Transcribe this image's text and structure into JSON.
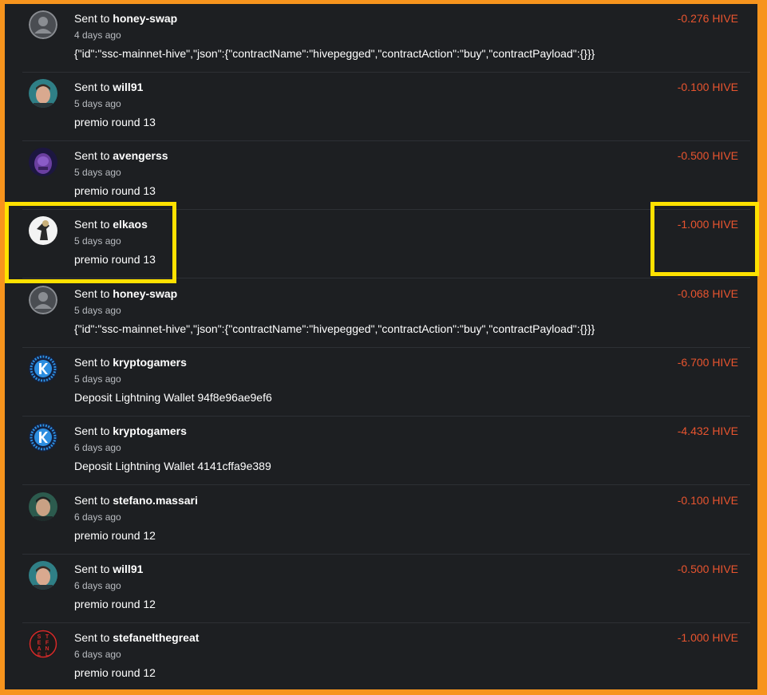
{
  "colors": {
    "frame_border": "#f7941d",
    "background": "#1d1f22",
    "amount": "#e8542f",
    "highlight": "#ffe100"
  },
  "transfers": [
    {
      "prefix": "Sent to",
      "to": "honey-swap",
      "time": "4 days ago",
      "memo": "{\"id\":\"ssc-mainnet-hive\",\"json\":{\"contractName\":\"hivepegged\",\"contractAction\":\"buy\",\"contractPayload\":{}}}",
      "amount": "-0.276 HIVE",
      "avatar": "default-user-icon"
    },
    {
      "prefix": "Sent to",
      "to": "will91",
      "time": "5 days ago",
      "memo": "premio round 13",
      "amount": "-0.100 HIVE",
      "avatar": "user-photo-avatar"
    },
    {
      "prefix": "Sent to",
      "to": "avengerss",
      "time": "5 days ago",
      "memo": "premio round 13",
      "amount": "-0.500 HIVE",
      "avatar": "purple-character-avatar"
    },
    {
      "prefix": "Sent to",
      "to": "elkaos",
      "time": "5 days ago",
      "memo": "premio round 13",
      "amount": "-1.000 HIVE",
      "avatar": "figure-avatar"
    },
    {
      "prefix": "Sent to",
      "to": "honey-swap",
      "time": "5 days ago",
      "memo": "{\"id\":\"ssc-mainnet-hive\",\"json\":{\"contractName\":\"hivepegged\",\"contractAction\":\"buy\",\"contractPayload\":{}}}",
      "amount": "-0.068 HIVE",
      "avatar": "default-user-icon"
    },
    {
      "prefix": "Sent to",
      "to": "kryptogamers",
      "time": "5 days ago",
      "memo": "Deposit Lightning Wallet 94f8e96ae9ef6",
      "amount": "-6.700 HIVE",
      "avatar": "kg-logo-avatar"
    },
    {
      "prefix": "Sent to",
      "to": "kryptogamers",
      "time": "6 days ago",
      "memo": "Deposit Lightning Wallet 4141cffa9e389",
      "amount": "-4.432 HIVE",
      "avatar": "kg-logo-avatar"
    },
    {
      "prefix": "Sent to",
      "to": "stefano.massari",
      "time": "6 days ago",
      "memo": "premio round 12",
      "amount": "-0.100 HIVE",
      "avatar": "user-photo-avatar"
    },
    {
      "prefix": "Sent to",
      "to": "will91",
      "time": "6 days ago",
      "memo": "premio round 12",
      "amount": "-0.500 HIVE",
      "avatar": "user-photo-avatar"
    },
    {
      "prefix": "Sent to",
      "to": "stefanelthegreat",
      "time": "6 days ago",
      "memo": "premio round 12",
      "amount": "-1.000 HIVE",
      "avatar": "stefanel-logo-avatar"
    }
  ],
  "stefanel_logo_letters": [
    "S",
    "T",
    "E",
    "F",
    "A",
    "N",
    "E",
    "L"
  ]
}
